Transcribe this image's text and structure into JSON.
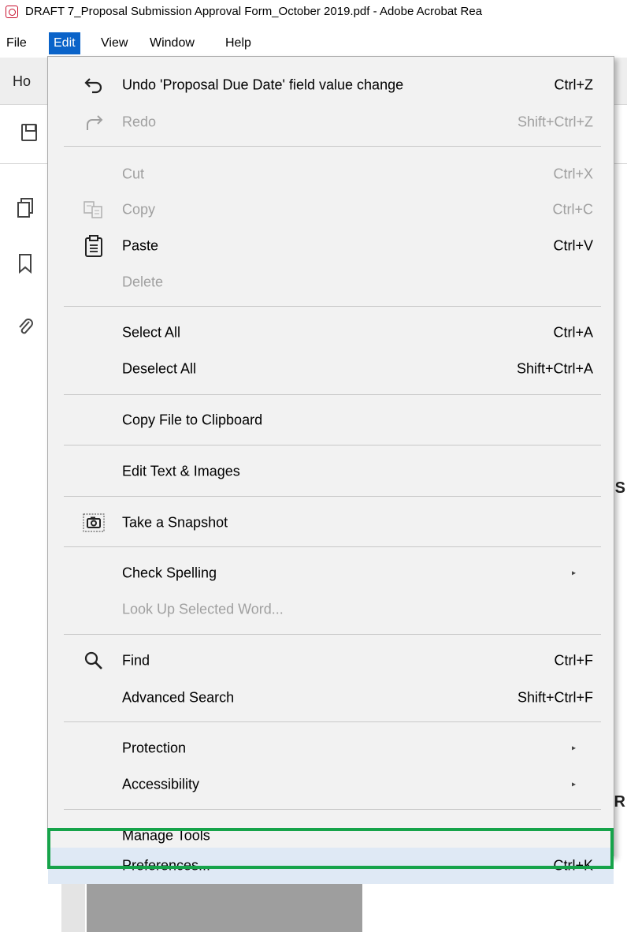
{
  "window": {
    "title": "DRAFT 7_Proposal Submission Approval Form_October 2019.pdf - Adobe Acrobat Rea"
  },
  "menubar": {
    "items": [
      {
        "label": "File"
      },
      {
        "label": "Edit"
      },
      {
        "label": "View"
      },
      {
        "label": "Window"
      },
      {
        "label": "Help"
      }
    ]
  },
  "background": {
    "tab_label": "Ho",
    "letter_s": "S",
    "letter_r": "R"
  },
  "edit_menu": {
    "items": [
      {
        "label": "Undo 'Proposal Due Date' field value change",
        "shortcut": "Ctrl+Z",
        "icon": "undo-icon",
        "enabled": true
      },
      {
        "label": "Redo",
        "shortcut": "Shift+Ctrl+Z",
        "icon": "redo-icon",
        "enabled": false
      },
      {
        "label": "Cut",
        "shortcut": "Ctrl+X",
        "enabled": false
      },
      {
        "label": "Copy",
        "shortcut": "Ctrl+C",
        "icon": "copy-icon",
        "enabled": false
      },
      {
        "label": "Paste",
        "shortcut": "Ctrl+V",
        "icon": "clipboard-icon",
        "enabled": true
      },
      {
        "label": "Delete",
        "shortcut": "",
        "enabled": false
      },
      {
        "label": "Select All",
        "shortcut": "Ctrl+A",
        "enabled": true
      },
      {
        "label": "Deselect All",
        "shortcut": "Shift+Ctrl+A",
        "enabled": true
      },
      {
        "label": "Copy File to Clipboard",
        "shortcut": "",
        "enabled": true
      },
      {
        "label": "Edit Text & Images",
        "shortcut": "",
        "enabled": true
      },
      {
        "label": "Take a Snapshot",
        "shortcut": "",
        "icon": "camera-icon",
        "enabled": true
      },
      {
        "label": "Check Spelling",
        "shortcut": "",
        "submenu": true,
        "enabled": true
      },
      {
        "label": "Look Up Selected Word...",
        "shortcut": "",
        "enabled": false
      },
      {
        "label": "Find",
        "shortcut": "Ctrl+F",
        "icon": "search-icon",
        "enabled": true
      },
      {
        "label": "Advanced Search",
        "shortcut": "Shift+Ctrl+F",
        "enabled": true
      },
      {
        "label": "Protection",
        "shortcut": "",
        "submenu": true,
        "enabled": true
      },
      {
        "label": "Accessibility",
        "shortcut": "",
        "submenu": true,
        "enabled": true
      },
      {
        "label": "Manage Tools",
        "shortcut": "",
        "enabled": true
      },
      {
        "label": "Preferences...",
        "shortcut": "Ctrl+K",
        "enabled": true,
        "highlighted": true
      }
    ],
    "submenu_arrow": "▸"
  },
  "colors": {
    "menu_active_bg": "#0a63c9",
    "highlight_border": "#16a34a",
    "disabled_text": "#a0a0a0"
  }
}
